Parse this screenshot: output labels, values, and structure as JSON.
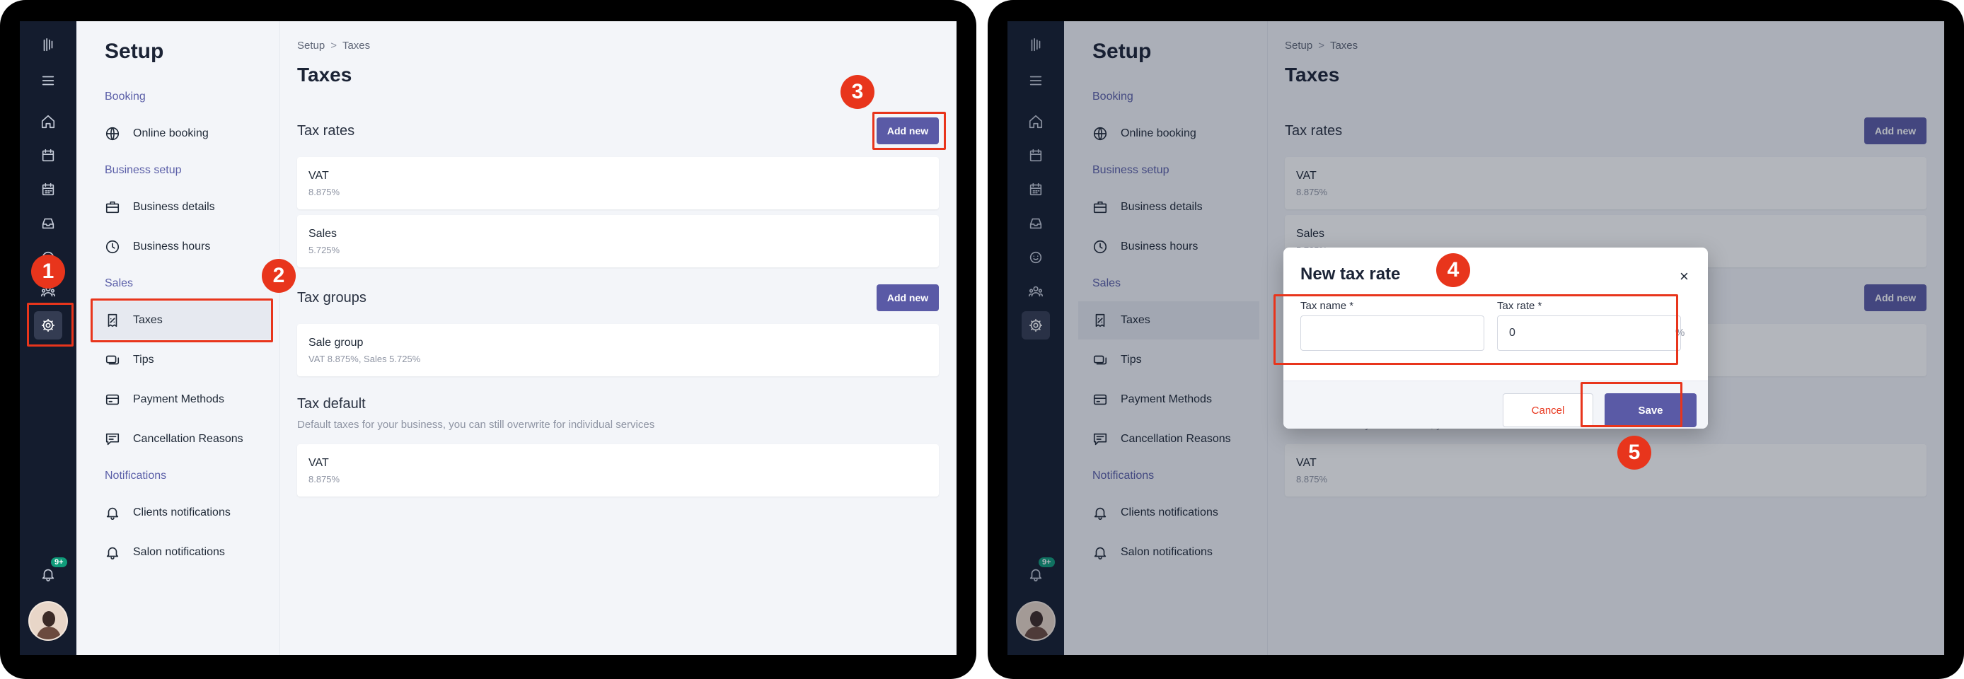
{
  "setup": {
    "title": "Setup",
    "sections": {
      "booking": "Booking",
      "business_setup": "Business setup",
      "sales": "Sales",
      "notifications": "Notifications"
    },
    "items": {
      "online_booking": "Online booking",
      "business_details": "Business details",
      "business_hours": "Business hours",
      "taxes": "Taxes",
      "tips": "Tips",
      "payment_methods": "Payment Methods",
      "cancellation_reasons": "Cancellation Reasons",
      "clients_notifications": "Clients notifications",
      "salon_notifications": "Salon notifications"
    }
  },
  "rail": {
    "notification_badge": "9+",
    "icons": [
      "logo-icon",
      "menu-icon",
      "home-icon",
      "calendar-icon",
      "calendar-grid-icon",
      "inbox-icon",
      "smile-icon",
      "team-icon",
      "gear-icon",
      "bell-icon"
    ]
  },
  "breadcrumb": {
    "root": "Setup",
    "separator": ">",
    "current": "Taxes"
  },
  "page_title": "Taxes",
  "tax_rates": {
    "title": "Tax rates",
    "add_label": "Add new",
    "items": [
      {
        "name": "VAT",
        "rate": "8.875%"
      },
      {
        "name": "Sales",
        "rate": "5.725%"
      }
    ]
  },
  "tax_groups": {
    "title": "Tax groups",
    "add_label": "Add new",
    "items": [
      {
        "name": "Sale group",
        "detail": "VAT 8.875%, Sales 5.725%"
      }
    ]
  },
  "tax_default": {
    "title": "Tax default",
    "description": "Default taxes for your business, you can still overwrite for individual services",
    "items": [
      {
        "name": "VAT",
        "rate": "8.875%"
      }
    ]
  },
  "modal": {
    "title": "New tax rate",
    "close": "×",
    "tax_name_label": "Tax name *",
    "tax_name_value": "",
    "tax_rate_label": "Tax rate *",
    "tax_rate_value": "0",
    "unit": "%",
    "cancel_label": "Cancel",
    "save_label": "Save"
  },
  "steps": [
    "1",
    "2",
    "3",
    "4",
    "5"
  ],
  "colors": {
    "accent": "#5a5aa6",
    "annotation": "#e8351c",
    "rail": "#141c2e"
  }
}
